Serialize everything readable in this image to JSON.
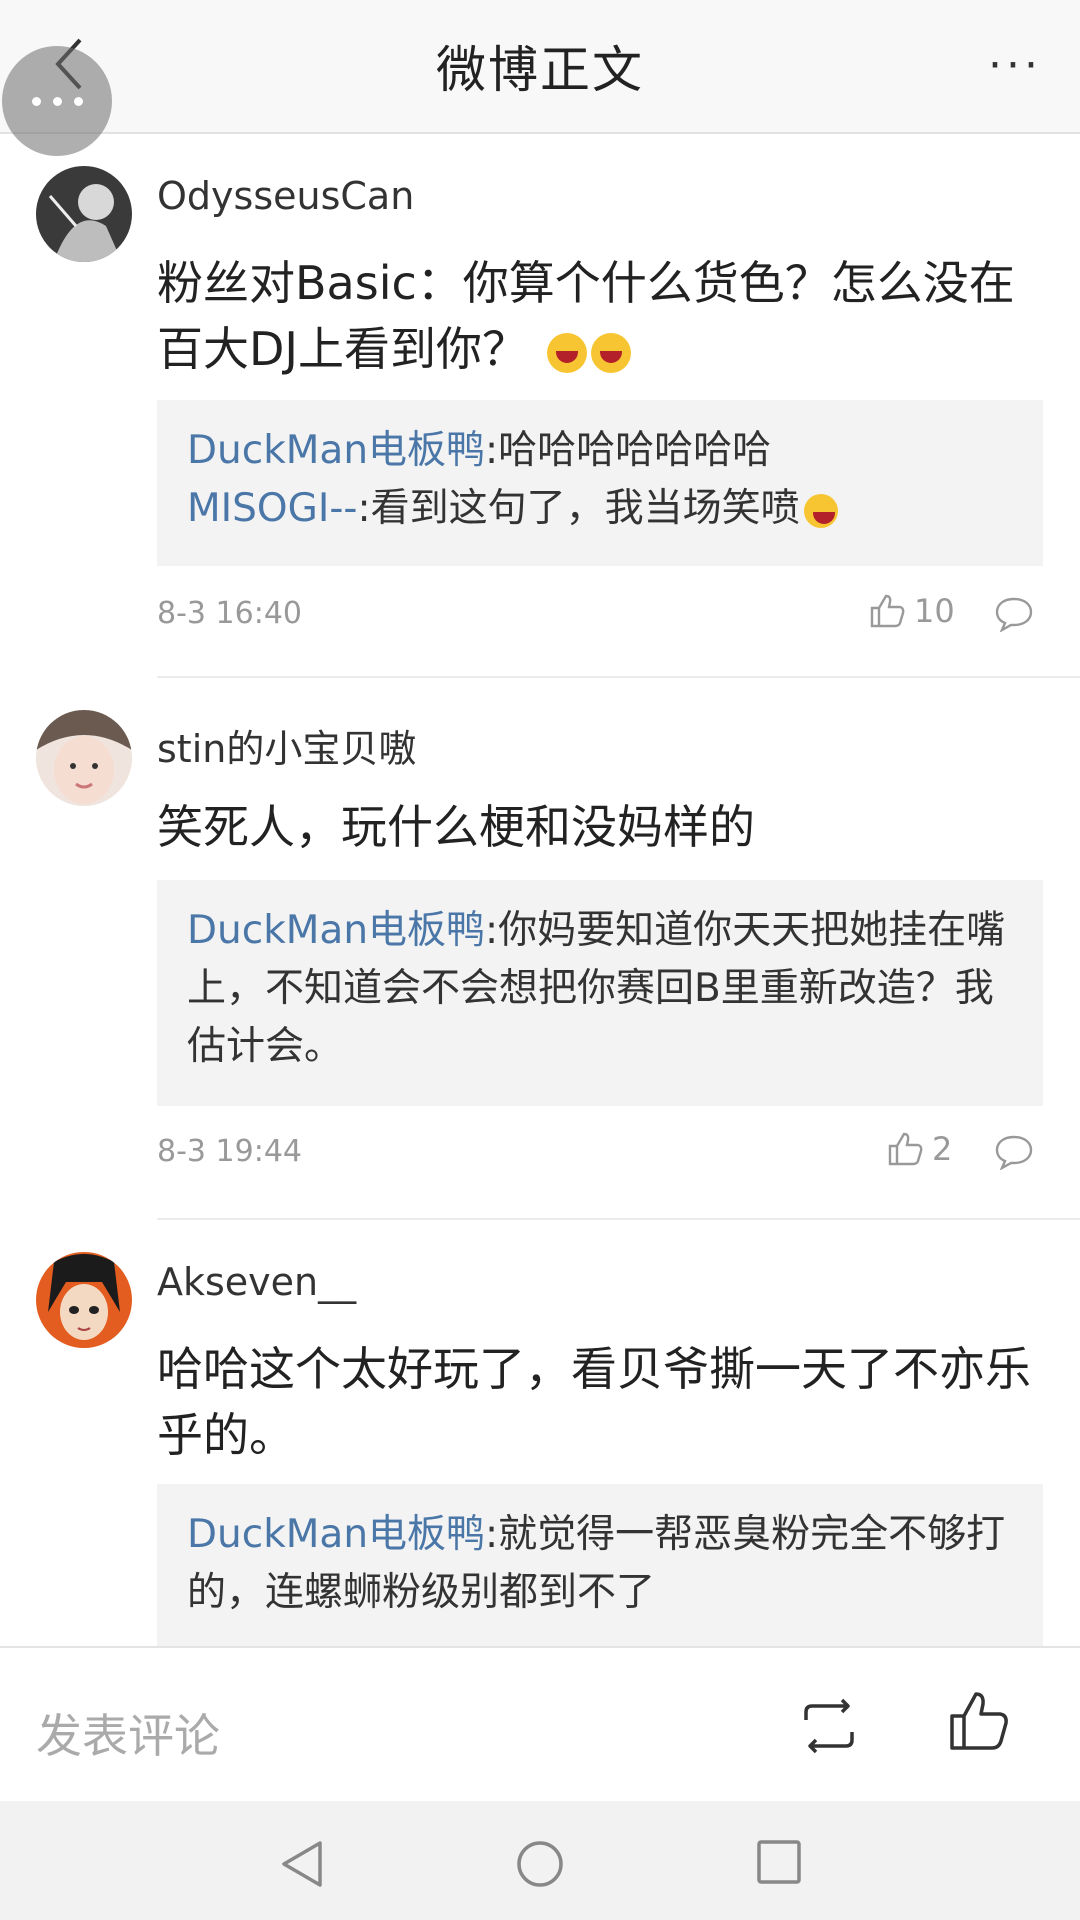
{
  "header": {
    "title": "微博正文",
    "more": "···"
  },
  "comments": [
    {
      "username": "OdysseusCan",
      "content": "粉丝对Basic：你算个什么货色？怎么没在百大DJ上看到你？",
      "replies": [
        {
          "user": "DuckMan电板鸭",
          "text": ":哈哈哈哈哈哈哈"
        },
        {
          "user": "MISOGI--",
          "text": ":看到这句了，我当场笑喷"
        }
      ],
      "time": "8-3 16:40",
      "likes": "10"
    },
    {
      "username": "stin的小宝贝嗷",
      "content": "笑死人，玩什么梗和没妈样的",
      "replies": [
        {
          "user": "DuckMan电板鸭",
          "text": ":你妈要知道你天天把她挂在嘴上，不知道会不会想把你赛回B里重新改造？我估计会。"
        }
      ],
      "time": "8-3 19:44",
      "likes": "2"
    },
    {
      "username": "Akseven__",
      "content": "哈哈这个太好玩了，看贝爷撕一天了不亦乐乎的。",
      "replies": [
        {
          "user": "DuckMan电板鸭",
          "text": ":就觉得一帮恶臭粉完全不够打的，连螺蛳粉级别都到不了"
        }
      ]
    }
  ],
  "bottom_bar": {
    "placeholder": "发表评论"
  },
  "colors": {
    "link": "#4a76a8",
    "meta": "#999999",
    "reply_bg": "#f3f3f3"
  }
}
